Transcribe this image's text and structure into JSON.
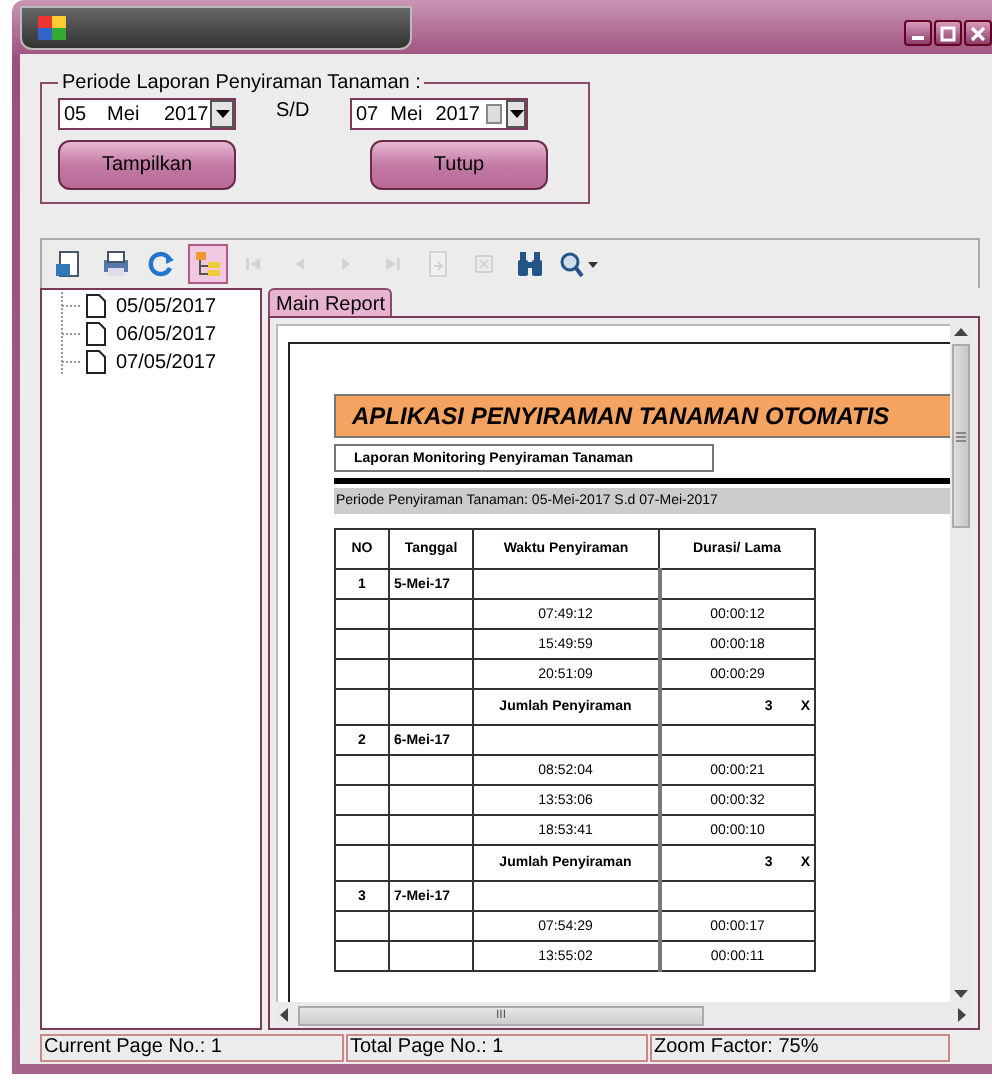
{
  "group": {
    "legend": "Periode Laporan Penyiraman Tanaman :",
    "from": {
      "day": "05",
      "month": "Mei",
      "year": "2017",
      "checkbox": false
    },
    "separator": "S/D",
    "to": {
      "day": "07",
      "month": "Mei",
      "year": "2017",
      "checkbox": true
    },
    "buttons": [
      "Tampilkan",
      "Tutup"
    ]
  },
  "toolbar": [
    {
      "kind": "export",
      "disabled": false,
      "selected": false
    },
    {
      "kind": "print",
      "disabled": false,
      "selected": false
    },
    {
      "kind": "refresh",
      "disabled": false,
      "selected": false
    },
    {
      "kind": "tree",
      "disabled": false,
      "selected": true
    },
    {
      "kind": "first",
      "disabled": true,
      "selected": false
    },
    {
      "kind": "prev",
      "disabled": true,
      "selected": false
    },
    {
      "kind": "next",
      "disabled": true,
      "selected": false
    },
    {
      "kind": "last",
      "disabled": true,
      "selected": false
    },
    {
      "kind": "goto",
      "disabled": true,
      "selected": false
    },
    {
      "kind": "stop",
      "disabled": true,
      "selected": false
    },
    {
      "kind": "search",
      "disabled": false,
      "selected": false
    },
    {
      "kind": "zoom",
      "disabled": false,
      "selected": false
    }
  ],
  "tree": [
    "05/05/2017",
    "06/05/2017",
    "07/05/2017"
  ],
  "tab": {
    "label": "Main Report",
    "selected": true
  },
  "report": {
    "title": "APLIKASI PENYIRAMAN TANAMAN OTOMATIS",
    "subtitle": "Laporan Monitoring Penyiraman Tanaman",
    "period": "Periode Penyiraman Tanaman: 05-Mei-2017 S.d 07-Mei-2017",
    "columns": [
      "NO",
      "Tanggal",
      "Waktu Penyiraman",
      "Durasi/ Lama"
    ],
    "rows": [
      {
        "kind": "date",
        "no": "1",
        "date": "5-Mei-17"
      },
      {
        "kind": "time",
        "time": "07:49:12",
        "duration": "00:00:12"
      },
      {
        "kind": "time",
        "time": "15:49:59",
        "duration": "00:00:18"
      },
      {
        "kind": "time",
        "time": "20:51:09",
        "duration": "00:00:29"
      },
      {
        "kind": "total",
        "label": "Jumlah Penyiraman",
        "count": "3",
        "unit": "X"
      },
      {
        "kind": "date",
        "no": "2",
        "date": "6-Mei-17"
      },
      {
        "kind": "time",
        "time": "08:52:04",
        "duration": "00:00:21"
      },
      {
        "kind": "time",
        "time": "13:53:06",
        "duration": "00:00:32"
      },
      {
        "kind": "time",
        "time": "18:53:41",
        "duration": "00:00:10"
      },
      {
        "kind": "total",
        "label": "Jumlah Penyiraman",
        "count": "3",
        "unit": "X"
      },
      {
        "kind": "date",
        "no": "3",
        "date": "7-Mei-17"
      },
      {
        "kind": "time",
        "time": "07:54:29",
        "duration": "00:00:17"
      },
      {
        "kind": "time",
        "time": "13:55:02",
        "duration": "00:00:11"
      }
    ]
  },
  "hscroll_grip": "III",
  "status_bar": [
    "Current Page No.: 1",
    "Total Page No.: 1",
    "Zoom Factor: 75%"
  ]
}
